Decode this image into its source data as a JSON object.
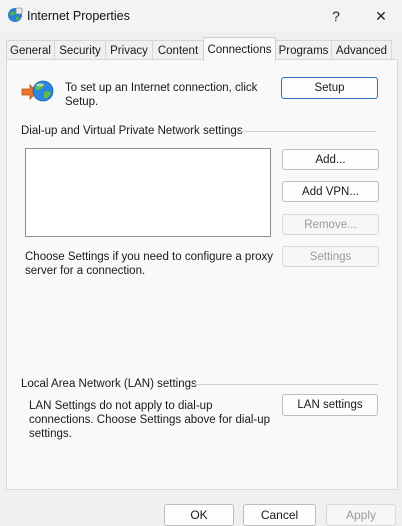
{
  "window": {
    "title": "Internet Properties",
    "help_glyph": "?",
    "close_glyph": "✕"
  },
  "tabs": [
    {
      "label": "General"
    },
    {
      "label": "Security"
    },
    {
      "label": "Privacy"
    },
    {
      "label": "Content"
    },
    {
      "label": "Connections",
      "active": true
    },
    {
      "label": "Programs"
    },
    {
      "label": "Advanced"
    }
  ],
  "setup": {
    "text": "To set up an Internet connection, click Setup.",
    "button": "Setup",
    "icon": "internet-globe-icon"
  },
  "dialup": {
    "group_label": "Dial-up and Virtual Private Network settings",
    "add_button": "Add...",
    "add_vpn_button": "Add VPN...",
    "remove_button": "Remove...",
    "settings_button": "Settings",
    "proxy_text": "Choose Settings if you need to configure a proxy server for a connection."
  },
  "lan": {
    "group_label": "Local Area Network (LAN) settings",
    "text": "LAN Settings do not apply to dial-up connections. Choose Settings above for dial-up settings.",
    "button": "LAN settings"
  },
  "footer": {
    "ok": "OK",
    "cancel": "Cancel",
    "apply": "Apply"
  },
  "colors": {
    "accent_border": "#2a6fc4",
    "disabled_text": "#9a9a9a"
  }
}
